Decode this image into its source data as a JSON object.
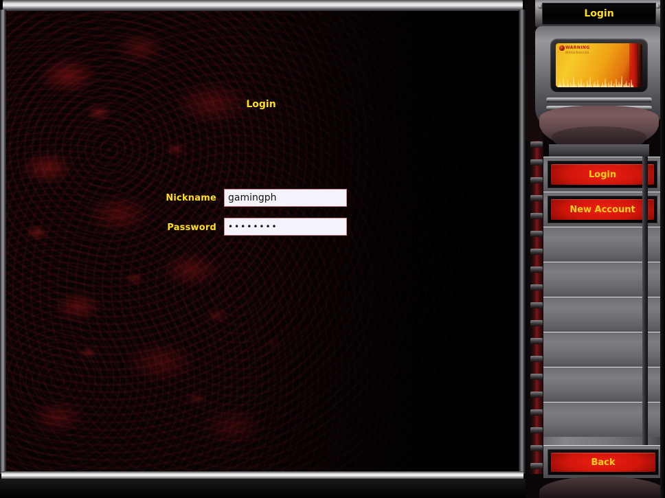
{
  "main": {
    "form_title": "Login",
    "fields": [
      {
        "label": "Nickname",
        "value": "gamingph",
        "type": "text"
      },
      {
        "label": "Password",
        "value": "••••••••",
        "type": "password"
      }
    ]
  },
  "sidebar": {
    "header_title": "Login",
    "display": {
      "warning_label": "WARNING",
      "warning_sub": "disturbances"
    },
    "buttons": [
      {
        "label": "Login",
        "state": "active"
      },
      {
        "label": "New Account",
        "state": "active"
      },
      {
        "label": "",
        "state": "empty"
      },
      {
        "label": "",
        "state": "empty"
      },
      {
        "label": "",
        "state": "empty"
      },
      {
        "label": "",
        "state": "empty"
      },
      {
        "label": "",
        "state": "empty"
      },
      {
        "label": "",
        "state": "empty"
      }
    ],
    "back_label": "Back"
  },
  "colors": {
    "accent_yellow": "#ffe01a",
    "button_red": "#d0150b",
    "button_text": "#ffd21a",
    "background_red": "#8c1416",
    "metal": "#7d7d81"
  }
}
